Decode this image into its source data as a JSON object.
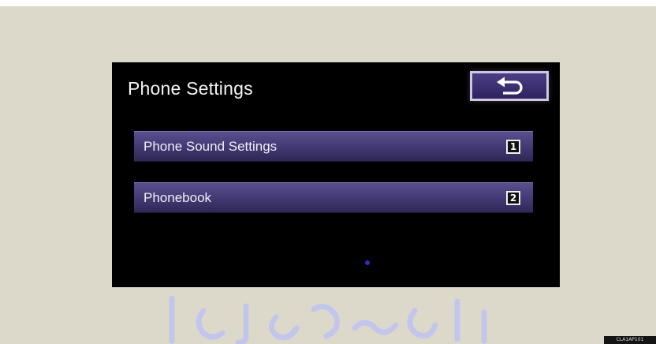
{
  "screen": {
    "title": "Phone Settings",
    "back_icon": "back-arrow-icon"
  },
  "menu": {
    "items": [
      {
        "label": "Phone Sound Settings",
        "badge": "1"
      },
      {
        "label": "Phonebook",
        "badge": "2"
      }
    ]
  },
  "figure_code": "CLA1AP101",
  "colors": {
    "page_background": "#dcd9cb",
    "screen_background": "#000000",
    "button_purple": "#463c77",
    "watermark_blue": "#2c2cc4"
  }
}
